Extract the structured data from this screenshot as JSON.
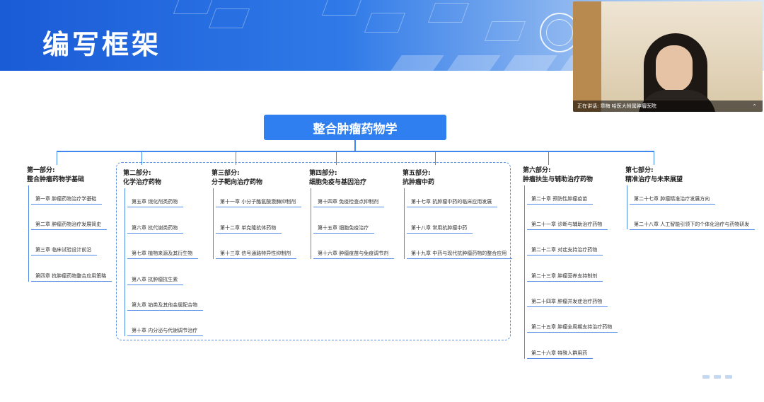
{
  "slide": {
    "title": "编写框架",
    "root": "整合肿瘤药物学"
  },
  "video": {
    "caption": "正在讲话: 章梅 哈医大附属肿瘤医院"
  },
  "parts": [
    {
      "label": "第一部分:",
      "name": "整合肿瘤药物学基础",
      "chapters": [
        "第一章 肿瘤药物治疗学基础",
        "第二章 肿瘤药物治疗发展简史",
        "第三章 临床试验设计前沿",
        "第四章 抗肿瘤药物整合应用策略"
      ]
    },
    {
      "label": "第二部分:",
      "name": "化学治疗药物",
      "chapters": [
        "第五章 烷化剂类药物",
        "第六章 抗代谢类药物",
        "第七章 植物来源及其衍生物",
        "第八章 抗肿瘤抗生素",
        "第九章 铂类及其他金属配合物",
        "第十章 内分泌与代谢调节治疗"
      ]
    },
    {
      "label": "第三部分:",
      "name": "分子靶向治疗药物",
      "chapters": [
        "第十一章 小分子酪氨酸激酶抑制剂",
        "第十二章 单克隆抗体药物",
        "第十三章 信号通路特异性抑制剂"
      ]
    },
    {
      "label": "第四部分:",
      "name": "细胞免疫与基因治疗",
      "chapters": [
        "第十四章 免疫检查点抑制剂",
        "第十五章 细胞免疫治疗",
        "第十六章 肿瘤疫苗与免疫调节剂"
      ]
    },
    {
      "label": "第五部分:",
      "name": "抗肿瘤中药",
      "chapters": [
        "第十七章 抗肿瘤中药的临床应用发展",
        "第十八章 常用抗肿瘤中药",
        "第十九章 中药与现代抗肿瘤药物的整合应用"
      ]
    },
    {
      "label": "第六部分:",
      "name": "肿瘤扶生与辅助治疗药物",
      "chapters": [
        "第二十章 预防性肿瘤疫苗",
        "第二十一章 诊断与辅助治疗药物",
        "第二十二章 对症支持治疗药物",
        "第二十三章 肿瘤营养支持制剂",
        "第二十四章 肿瘤并发症治疗药物",
        "第二十五章 肿瘤全周期支持治疗药物",
        "第二十六章 特殊人群用药"
      ]
    },
    {
      "label": "第七部分:",
      "name": "精准治疗与未来展望",
      "chapters": [
        "第二十七章 肿瘤精准治疗发展方向",
        "第二十八章 人工智能引领下的个体化治疗与药物研发"
      ]
    }
  ]
}
